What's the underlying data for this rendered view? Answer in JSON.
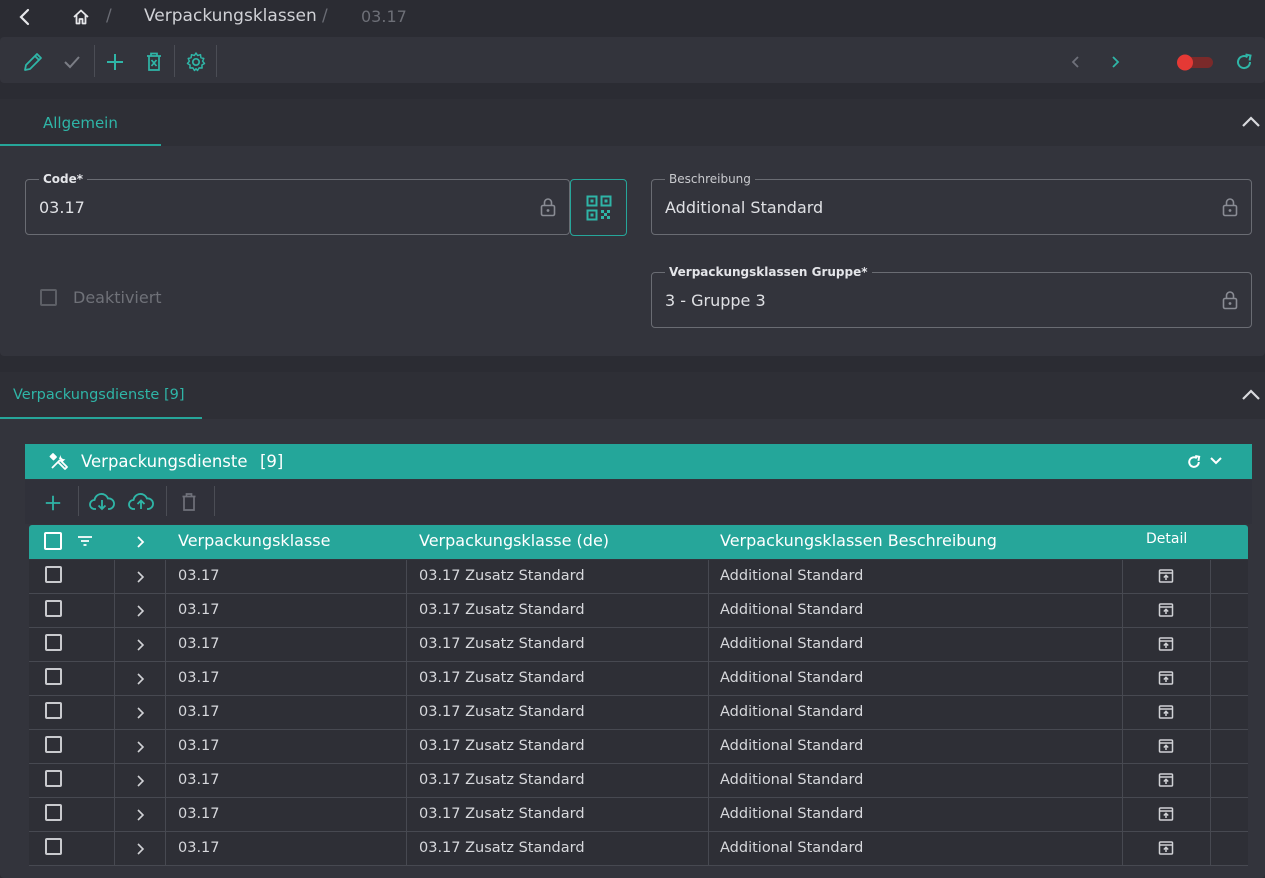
{
  "breadcrumb": {
    "items": [
      "Verpackungsklassen",
      "03.17"
    ]
  },
  "tabs": {
    "general": "Allgemein",
    "services": "Verpackungsdienste [9]"
  },
  "form": {
    "code_label": "Code*",
    "code_value": "03.17",
    "description_label": "Beschreibung",
    "description_value": "Additional Standard",
    "group_label": "Verpackungsklassen Gruppe*",
    "group_value": "3 - Gruppe 3",
    "deactivated_label": "Deaktiviert"
  },
  "grid": {
    "title": "Verpackungsdienste",
    "count": "[9]",
    "columns": [
      "Verpackungsklasse",
      "Verpackungsklasse (de)",
      "Verpackungsklassen Beschreibung",
      "Detail"
    ],
    "rows": [
      [
        "03.17",
        "03.17 Zusatz Standard",
        "Additional Standard"
      ],
      [
        "03.17",
        "03.17 Zusatz Standard",
        "Additional Standard"
      ],
      [
        "03.17",
        "03.17 Zusatz Standard",
        "Additional Standard"
      ],
      [
        "03.17",
        "03.17 Zusatz Standard",
        "Additional Standard"
      ],
      [
        "03.17",
        "03.17 Zusatz Standard",
        "Additional Standard"
      ],
      [
        "03.17",
        "03.17 Zusatz Standard",
        "Additional Standard"
      ],
      [
        "03.17",
        "03.17 Zusatz Standard",
        "Additional Standard"
      ],
      [
        "03.17",
        "03.17 Zusatz Standard",
        "Additional Standard"
      ],
      [
        "03.17",
        "03.17 Zusatz Standard",
        "Additional Standard"
      ]
    ]
  },
  "colors": {
    "accent": "#26a69a",
    "toggle_on": "#e53935",
    "background": "#2b2c33"
  },
  "icons": [
    "back-icon",
    "home-icon",
    "edit-icon",
    "check-icon",
    "add-icon",
    "delete-icon",
    "settings-icon",
    "prev-icon",
    "next-icon",
    "toggle-switch",
    "refresh-icon",
    "collapse-icon",
    "qr-code-icon",
    "lock-icon",
    "tools-icon",
    "chevron-down-icon",
    "download-cloud-icon",
    "upload-cloud-icon",
    "trash-icon",
    "filter-icon",
    "expand-row-icon",
    "detail-open-icon"
  ]
}
